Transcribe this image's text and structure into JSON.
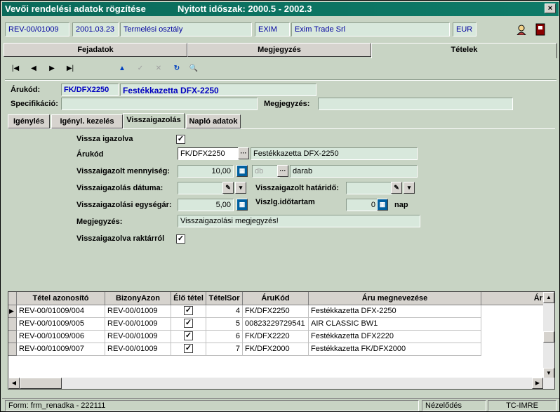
{
  "window": {
    "title": "Vevői rendelési adatok rögzítése",
    "period": "Nyitott időszak: 2000.5 - 2002.3",
    "close_label": "×"
  },
  "header": {
    "doc_id": "REV-00/01009",
    "date": "2001.03.23",
    "department": "Termelési osztály",
    "partner_code": "EXIM",
    "partner_name": "Exim Trade Srl",
    "currency": "EUR"
  },
  "tabs": [
    "Fejadatok",
    "Megjegyzés",
    "Tételek"
  ],
  "toolbar": {
    "first": "|◀",
    "prev": "◀",
    "next": "▶",
    "last": "▶|",
    "up": "▲",
    "confirm": "✓",
    "cancel": "✕",
    "refresh": "↻",
    "zoom": "🔍"
  },
  "item": {
    "code_label": "Árukód:",
    "code": "FK/DFX2250",
    "name": "Festékkazetta DFX-2250",
    "spec_label": "Specifikáció:",
    "spec": "",
    "note_label": "Megjegyzés:",
    "note": ""
  },
  "subtabs": [
    "Igénylés",
    "Igényl. kezelés",
    "Visszaigazolás",
    "Napló adatok"
  ],
  "confirm": {
    "returned_label": "Vissza igazolva",
    "returned_checked": "✓",
    "code_label": "Árukód",
    "code": "FK/DFX2250",
    "code_btn": "···",
    "code_name": "Festékkazetta DFX-2250",
    "qty_label": "Visszaigazolt mennyiség:",
    "qty": "10,00",
    "unit_code": "db",
    "unit_btn": "···",
    "unit_name": "darab",
    "date_label": "Visszaigazolás dátuma:",
    "date": "",
    "deadline_label": "Visszaigazolt határidő:",
    "deadline": "",
    "price_label": "Visszaigazolási egységár:",
    "price": "5,00",
    "duration_label": "Viszlg.időtartam",
    "duration": "0",
    "duration_unit": "nap",
    "note_label": "Megjegyzés:",
    "note": "Visszaigazolási megjegyzés!",
    "from_stock_label": "Visszaigazolva raktárról",
    "from_stock_checked": "✓"
  },
  "grid": {
    "columns": [
      "Tétel azonosító",
      "BizonyAzon",
      "Élő tétel",
      "TételSor",
      "ÁruKód",
      "Áru megnevezése",
      "Ár"
    ],
    "rows": [
      [
        "REV-00/01009/004",
        "REV-00/01009",
        "✓",
        "4",
        "FK/DFX2250",
        "Festékkazetta DFX-2250"
      ],
      [
        "REV-00/01009/005",
        "REV-00/01009",
        "✓",
        "5",
        "00823229729541",
        "AIR CLASSIC BW1"
      ],
      [
        "REV-00/01009/006",
        "REV-00/01009",
        "✓",
        "6",
        "FK/DFX2220",
        "Festékkazetta DFX2220"
      ],
      [
        "REV-00/01009/007",
        "REV-00/01009",
        "✓",
        "7",
        "FK/DFX2000",
        "Festékkazetta FK/DFX2000"
      ]
    ],
    "current_row_marker": "▶"
  },
  "status": {
    "form": "Form: frm_renadka - 222111",
    "mode": "Nézelődés",
    "user": "TC-IMRE"
  },
  "colors": {
    "title_bar": "#0B6A5A",
    "panel_bg": "#C8D4C4",
    "field_bg": "#D8E8DC",
    "value_text": "#0000C0"
  }
}
